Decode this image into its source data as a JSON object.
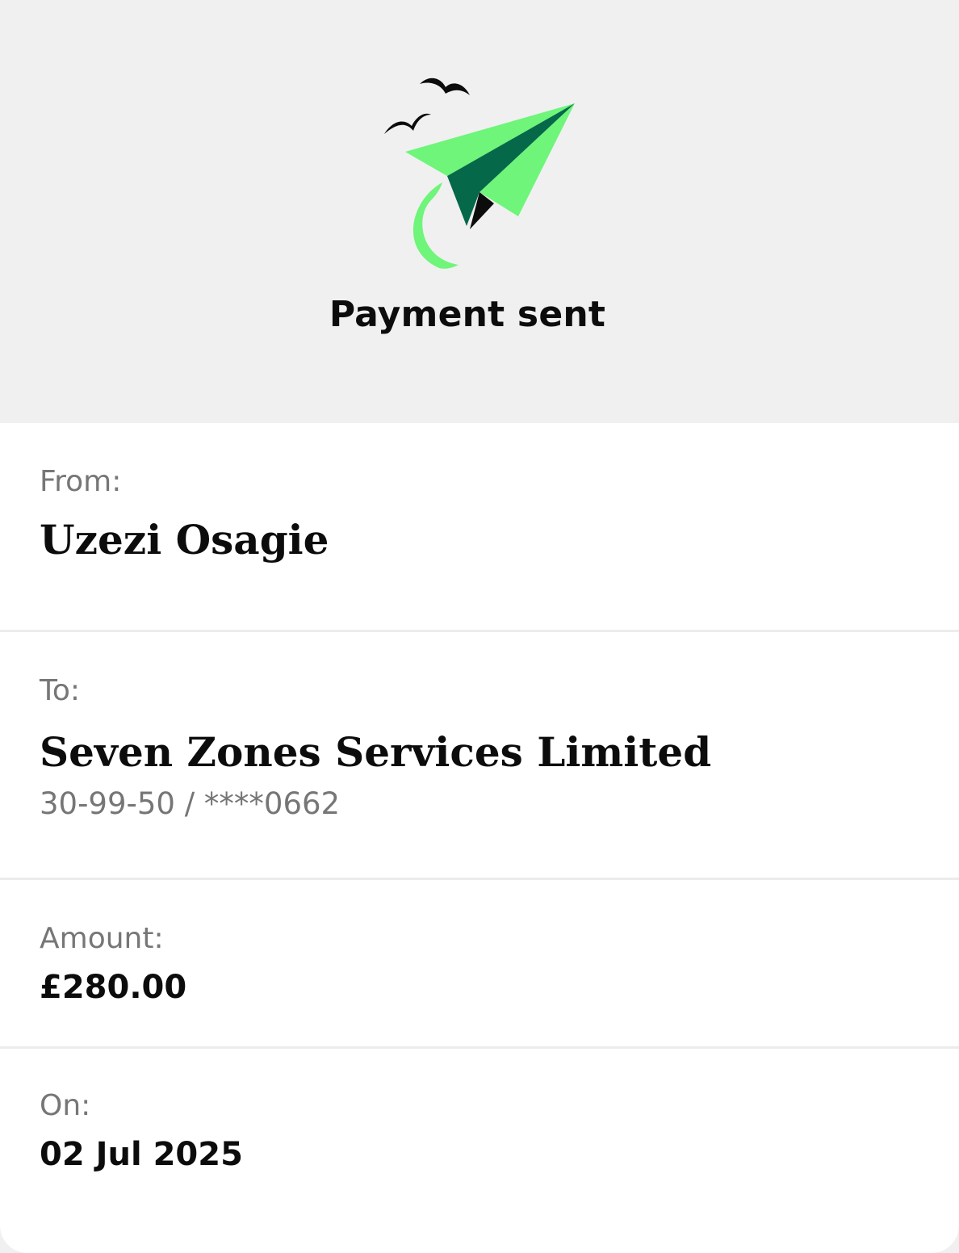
{
  "header": {
    "icon": "paper-plane-icon",
    "title": "Payment sent",
    "colors": {
      "plane_light": "#6ef57a",
      "plane_dark": "#046849"
    }
  },
  "from": {
    "label": "From:",
    "name": "Uzezi Osagie"
  },
  "to": {
    "label": "To:",
    "name": "Seven Zones Services Limited",
    "account": "30-99-50 / ****0662"
  },
  "amount": {
    "label": "Amount:",
    "value": "£280.00"
  },
  "date": {
    "label": "On:",
    "value": "02 Jul 2025"
  }
}
